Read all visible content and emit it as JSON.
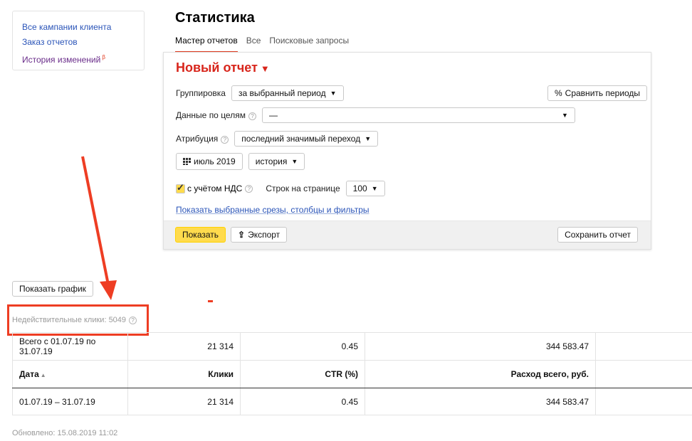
{
  "sidebar": {
    "links": [
      "Все кампании клиента",
      "Заказ отчетов",
      "История изменений"
    ],
    "beta_mark": "β"
  },
  "page": {
    "title": "Статистика",
    "tabs": [
      "Мастер отчетов",
      "Все",
      "Поисковые запросы"
    ]
  },
  "report": {
    "title": "Новый отчет",
    "title_arrow": "▼",
    "grouping_label": "Группировка",
    "grouping_value": "за выбранный период",
    "compare_button": "Сравнить периоды",
    "compare_icon": "%",
    "goals_label": "Данные по целям",
    "goals_value": "—",
    "attribution_label": "Атрибуция",
    "attribution_value": "последний значимый переход",
    "period_value": "июль 2019",
    "history_value": "история",
    "vat_label": "с учётом НДС",
    "vat_checked": true,
    "rows_label": "Строк на странице",
    "rows_value": "100",
    "show_slices_link": "Показать выбранные срезы, столбцы и фильтры",
    "show_button": "Показать",
    "export_button": "Экспорт",
    "save_button": "Сохранить отчет",
    "help_glyph": "?"
  },
  "graph_button": "Показать график",
  "invalid_clicks": "Недействительные клики: 5049",
  "table": {
    "total": [
      "Всего с 01.07.19 по 31.07.19",
      "21 314",
      "0.45",
      "344 583.47"
    ],
    "headers": [
      "Дата",
      "Клики",
      "CTR (%)",
      "Расход всего, руб."
    ],
    "sort_glyph": "▲",
    "rows": [
      [
        "01.07.19 – 31.07.19",
        "21 314",
        "0.45",
        "344 583.47"
      ]
    ]
  },
  "updated": "Обновлено: 15.08.2019 11:02",
  "colors": {
    "brand_red": "#d8261c",
    "link": "#2a54b8",
    "yellow": "#ffdb4d",
    "annotation": "#ee3d23"
  }
}
